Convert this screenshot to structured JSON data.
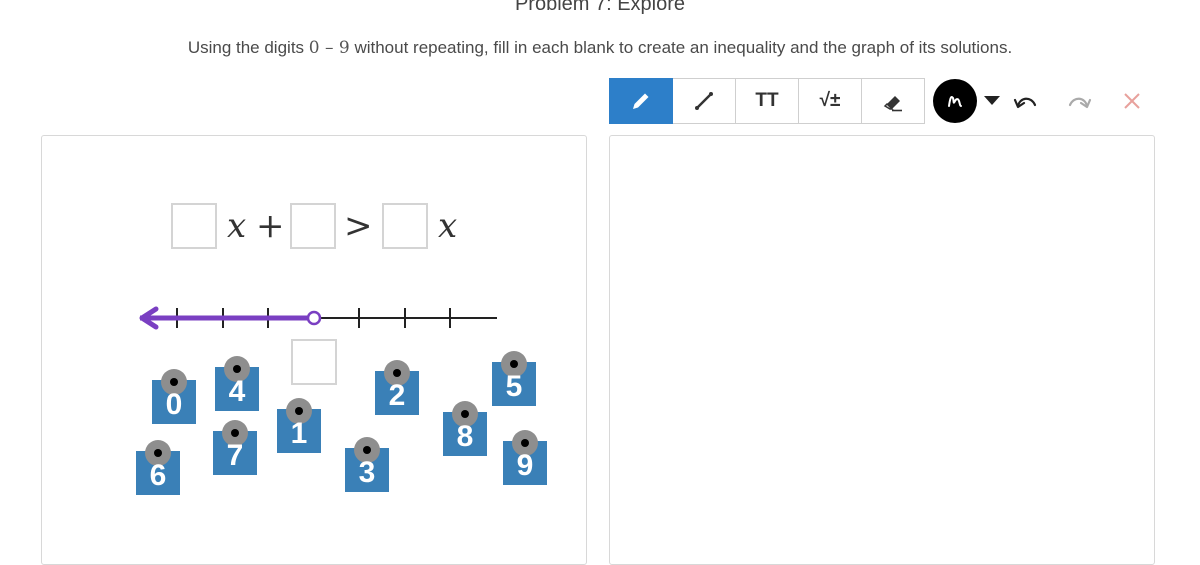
{
  "header": {
    "title": "Problem 7: Explore",
    "instructions_before": "Using the digits ",
    "instructions_math": "0 – 9",
    "instructions_after": " without repeating, fill in each blank to create an inequality and the graph of its solutions."
  },
  "toolbar": {
    "tools": [
      "pencil-icon",
      "line-icon",
      "text-icon",
      "math-icon",
      "eraser-icon"
    ],
    "text_tool_label": "TT",
    "math_tool_label": "√±",
    "active_tool": "pencil",
    "active_color": "#2d7fc9",
    "pen_color": "#000000"
  },
  "inequality": {
    "x1": "x",
    "plus": "+",
    "gt": ">",
    "x2": "x"
  },
  "number_line": {
    "shaded_direction": "left",
    "endpoint": "open",
    "color": "#7a3fc2"
  },
  "tiles": [
    "0",
    "4",
    "1",
    "2",
    "8",
    "5",
    "6",
    "7",
    "3",
    "9"
  ],
  "colors": {
    "tile": "#3a80b7",
    "clear": "#e8a19c"
  }
}
